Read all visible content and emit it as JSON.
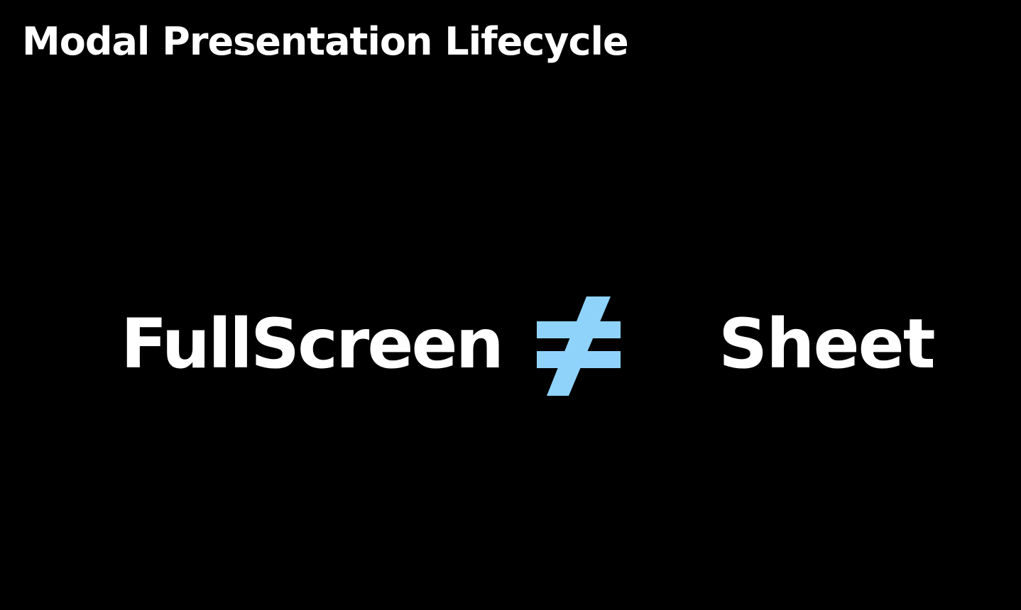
{
  "slide": {
    "title": "Modal Presentation Lifecycle",
    "left_term": "FullScreen",
    "right_term": "Sheet",
    "operator_icon": "not-equal-icon"
  },
  "colors": {
    "background": "#000000",
    "text": "#ffffff",
    "accent": "#8fd3fb"
  }
}
